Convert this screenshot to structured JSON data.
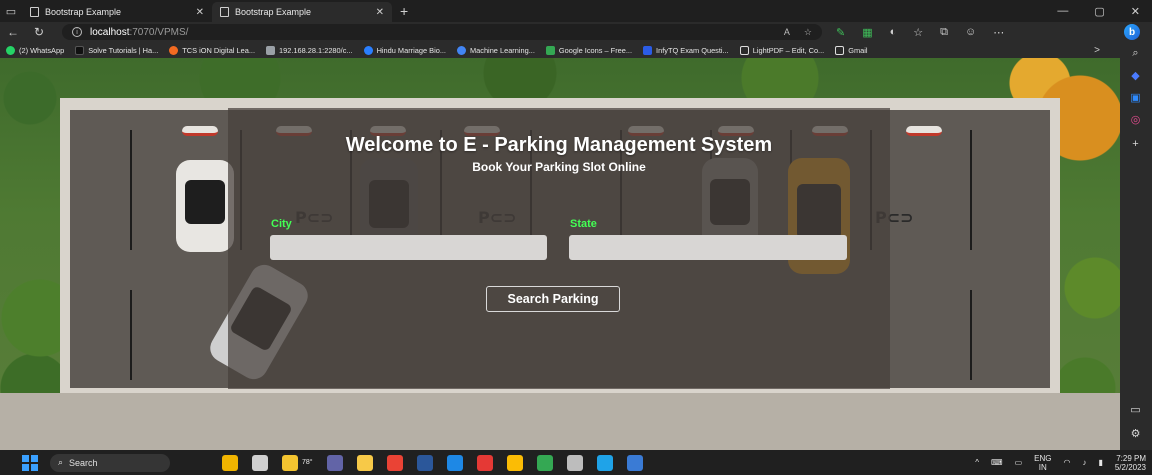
{
  "browser": {
    "tabs": [
      {
        "title": "Bootstrap Example",
        "active": false
      },
      {
        "title": "Bootstrap Example",
        "active": true
      }
    ],
    "new_tab_symbol": "+",
    "url_host": "localhost",
    "url_rest": ":7070/VPMS/",
    "window_controls": [
      "—",
      "▢",
      "✕"
    ]
  },
  "bookmarks": [
    {
      "label": "(2) WhatsApp",
      "color": "#25d366"
    },
    {
      "label": "Solve Tutorials | Ha...",
      "color": "#111111"
    },
    {
      "label": "TCS iON Digital Lea...",
      "color": "#f26a21"
    },
    {
      "label": "192.168.28.1:2280/c...",
      "color": "#9aa0a6"
    },
    {
      "label": "Hindu Marriage Bio...",
      "color": "#2a7fff"
    },
    {
      "label": "Machine Learning...",
      "color": "#4285f4"
    },
    {
      "label": "Google Icons – Free...",
      "color": "#34a853"
    },
    {
      "label": "InfyTQ Exam Questi...",
      "color": "#2b5ce6"
    },
    {
      "label": "LightPDF – Edit, Co...",
      "color": "#e0e0e0"
    },
    {
      "label": "Gmail",
      "color": "#e0e0e0"
    }
  ],
  "bookmarks_more": ">",
  "page": {
    "title": "Welcome to E - Parking Management System",
    "subtitle": "Book Your Parking Slot Online",
    "city_label": "City",
    "state_label": "State",
    "city_value": "",
    "state_value": "",
    "search_button": "Search Parking"
  },
  "taskbar": {
    "search_label": "Search",
    "weather": "78°",
    "language": "ENG",
    "region": "IN",
    "time": "7:29 PM",
    "date": "5/2/2023",
    "apps": [
      {
        "name": "widgets",
        "color": "#f0b400"
      },
      {
        "name": "task-view",
        "color": "#cfcfcf"
      },
      {
        "name": "weather",
        "color": "#f4c430"
      },
      {
        "name": "teams",
        "color": "#6264a7"
      },
      {
        "name": "file-explorer",
        "color": "#f7c948"
      },
      {
        "name": "chrome",
        "color": "#ea4335"
      },
      {
        "name": "word",
        "color": "#2b579a"
      },
      {
        "name": "app-blue",
        "color": "#1e88e5"
      },
      {
        "name": "app-red",
        "color": "#e53935"
      },
      {
        "name": "chrome-2",
        "color": "#fbbc05"
      },
      {
        "name": "chrome-3",
        "color": "#34a853"
      },
      {
        "name": "settings",
        "color": "#bdbdbd"
      },
      {
        "name": "edge",
        "color": "#1fa3e8"
      },
      {
        "name": "app-teal",
        "color": "#3a7bd5"
      }
    ]
  },
  "colors": {
    "label_green": "#43ff54",
    "overlay": "rgba(70,64,60,0.72)"
  }
}
